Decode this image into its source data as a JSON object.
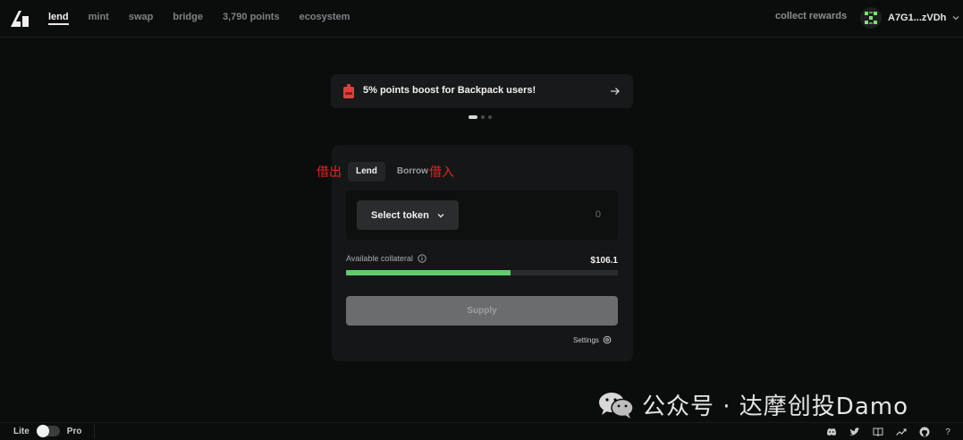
{
  "nav": {
    "items": [
      {
        "label": "lend",
        "active": true
      },
      {
        "label": "mint",
        "active": false
      },
      {
        "label": "swap",
        "active": false
      },
      {
        "label": "bridge",
        "active": false
      },
      {
        "label": "3,790 points",
        "active": false
      },
      {
        "label": "ecosystem",
        "active": false
      }
    ],
    "collect_label": "collect rewards",
    "wallet_label": "A7G1...zVDh"
  },
  "banner": {
    "text": "5% points boost for Backpack users!",
    "slides": 3,
    "active_slide": 1
  },
  "card": {
    "tabs": [
      {
        "label": "Lend",
        "active": true
      },
      {
        "label": "Borrow",
        "active": false
      }
    ],
    "annotations": {
      "lend": "借出",
      "borrow": "借入"
    },
    "select_token_label": "Select token",
    "amount_placeholder": "0",
    "collateral_label": "Available collateral",
    "collateral_value": "$106.1",
    "collateral_fill_fraction": 0.605,
    "supply_label": "Supply",
    "settings_label": "Settings"
  },
  "footer": {
    "lite_label": "Lite",
    "pro_label": "Pro",
    "icons": [
      "discord-icon",
      "twitter-icon",
      "docs-icon",
      "analytics-icon",
      "github-icon",
      "help-icon"
    ]
  },
  "watermark": {
    "text": "公众号 · 达摩创投Damo"
  },
  "colors": {
    "background": "#0b0c0c",
    "card": "#151617",
    "accent_green": "#5fcb6a",
    "annotation_red": "#e8261d"
  }
}
